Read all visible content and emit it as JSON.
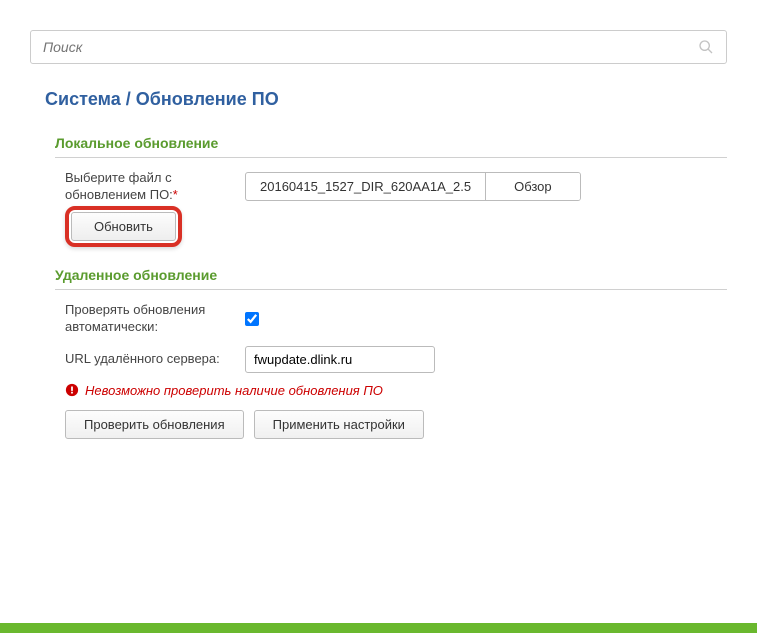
{
  "search": {
    "placeholder": "Поиск"
  },
  "breadcrumb": {
    "system": "Система",
    "separator": " / ",
    "page": "Обновление ПО"
  },
  "local": {
    "title": "Локальное обновление",
    "file_label": "Выберите файл с обновлением ПО:",
    "required": "*",
    "file_name": "20160415_1527_DIR_620AA1A_2.5",
    "browse": "Обзор",
    "update": "Обновить"
  },
  "remote": {
    "title": "Удаленное обновление",
    "auto_check_label": "Проверять обновления автоматически:",
    "auto_check_value": true,
    "url_label": "URL удалённого сервера:",
    "url_value": "fwupdate.dlink.ru",
    "error": "Невозможно проверить наличие обновления ПО",
    "check_btn": "Проверить обновления",
    "apply_btn": "Применить настройки"
  }
}
